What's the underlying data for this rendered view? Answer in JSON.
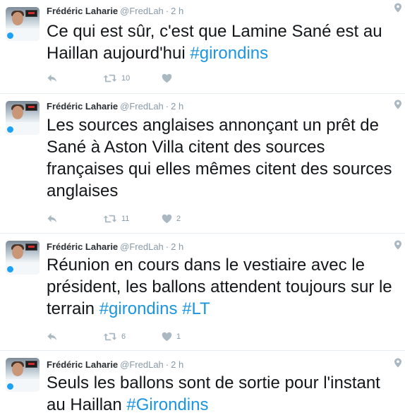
{
  "tweets": [
    {
      "author": "Frédéric Laharie",
      "handle": "@FredLah",
      "separator": "·",
      "time": "2 h",
      "text_plain": "Ce qui est sûr, c'est que Lamine Sané est au Haillan aujourd'hui ",
      "hashtag1": "#girondins",
      "mid": "",
      "hashtag2": "",
      "retweets": "10",
      "likes": ""
    },
    {
      "author": "Frédéric Laharie",
      "handle": "@FredLah",
      "separator": "·",
      "time": "2 h",
      "text_plain": "Les sources anglaises annonçant un prêt de Sané à Aston Villa citent des sources françaises qui elles mêmes citent des sources anglaises",
      "hashtag1": "",
      "mid": "",
      "hashtag2": "",
      "retweets": "11",
      "likes": "2"
    },
    {
      "author": "Frédéric Laharie",
      "handle": "@FredLah",
      "separator": "·",
      "time": "2 h",
      "text_plain": "Réunion en cours dans le vestiaire avec le président, les ballons attendent toujours sur le terrain ",
      "hashtag1": "#girondins",
      "mid": " ",
      "hashtag2": "#LT",
      "retweets": "6",
      "likes": "1"
    },
    {
      "author": "Frédéric Laharie",
      "handle": "@FredLah",
      "separator": "·",
      "time": "2 h",
      "text_plain": "Seuls les ballons sont de sortie pour l'instant au Haillan ",
      "hashtag1": "#Girondins",
      "mid": "",
      "hashtag2": "",
      "retweets": "",
      "likes": ""
    }
  ],
  "icons": {
    "reply": "reply-icon",
    "retweet": "retweet-icon",
    "like": "heart-icon",
    "location": "location-pin-icon"
  },
  "colors": {
    "hashtag": "#1b95e0",
    "meta": "#8899a6",
    "text": "#14171a",
    "separator": "#e6ecf0"
  }
}
